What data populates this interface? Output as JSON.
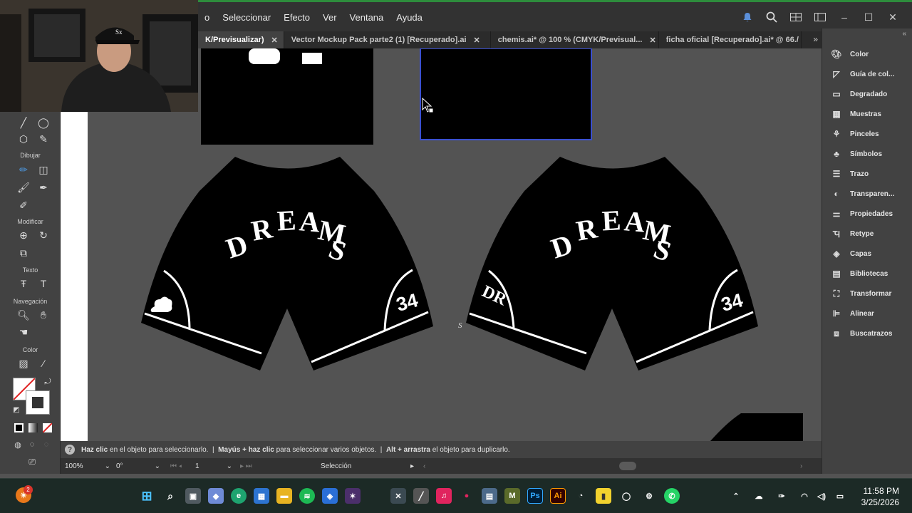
{
  "menubar": {
    "items": [
      "o",
      "Seleccionar",
      "Efecto",
      "Ver",
      "Ventana",
      "Ayuda"
    ]
  },
  "tabs": [
    {
      "label": "K/Previsualizar)",
      "active": true
    },
    {
      "label": "Vector Mockup Pack parte2  (1) [Recuperado].ai",
      "active": false
    },
    {
      "label": "chemis.ai* @ 100 % (CMYK/Previsual...",
      "active": false
    },
    {
      "label": "ficha oficial [Recuperado].ai* @ 66./",
      "active": false
    }
  ],
  "toolbar": {
    "sections": [
      "Dibujar",
      "Modificar",
      "Texto",
      "Navegación",
      "Color"
    ]
  },
  "right_panel": {
    "items": [
      "Color",
      "Guía de col...",
      "Degradado",
      "Muestras",
      "Pinceles",
      "Símbolos",
      "Trazo",
      "Transparen...",
      "Propiedades",
      "Retype",
      "Capas",
      "Bibliotecas",
      "Transformar",
      "Alinear",
      "Buscatrazos"
    ]
  },
  "hint": {
    "p1_bold": "Haz clic",
    "p1": " en el objeto para seleccionarlo.  |  ",
    "p2_bold": "Mayús + haz clic",
    "p2": " para seleccionar varios objetos.  |  ",
    "p3_bold": "Alt + arrastra",
    "p3": " el objeto para duplicarlo."
  },
  "statusbar": {
    "zoom": "100%",
    "rotation": "0°",
    "artboard": "1",
    "tool": "Selección"
  },
  "artwork": {
    "text": "DREAMS",
    "number": "34",
    "monogram": "DR",
    "small_mark": "S"
  },
  "taskbar": {
    "badge": "2",
    "time": "11:58 PM",
    "date": "3/25/2026"
  },
  "colors": {
    "menubar": "#323232",
    "panel": "#424242",
    "canvas": "#535353",
    "shorts": "#000000"
  }
}
